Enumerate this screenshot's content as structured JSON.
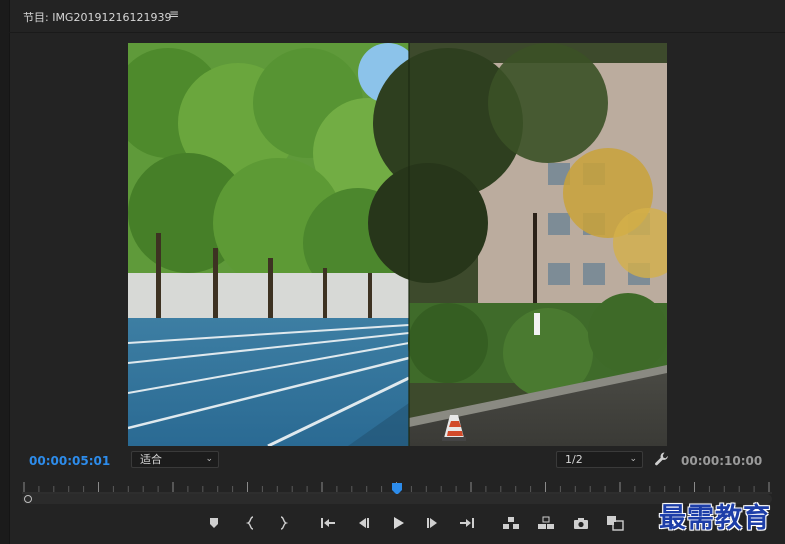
{
  "panel": {
    "title": "节目: IMG20191216121939",
    "menu_glyph": "≡"
  },
  "playback": {
    "current_time": "00:00:05:01",
    "duration": "00:00:10:00",
    "zoom_level": "适合",
    "resolution": "1/2",
    "playhead_fraction": 0.5
  },
  "controls": [
    {
      "name": "add-marker-button",
      "icon": "marker-icon"
    },
    {
      "name": "mark-in-button",
      "icon": "mark-in-icon"
    },
    {
      "name": "mark-out-button",
      "icon": "mark-out-icon"
    },
    {
      "name": "go-to-in-button",
      "icon": "go-to-in-icon"
    },
    {
      "name": "step-back-button",
      "icon": "step-back-icon"
    },
    {
      "name": "play-button",
      "icon": "play-icon"
    },
    {
      "name": "step-forward-button",
      "icon": "step-forward-icon"
    },
    {
      "name": "go-to-out-button",
      "icon": "go-to-out-icon"
    },
    {
      "name": "lift-button",
      "icon": "lift-icon"
    },
    {
      "name": "extract-button",
      "icon": "extract-icon"
    },
    {
      "name": "export-frame-button",
      "icon": "camera-icon"
    },
    {
      "name": "comparison-view-button",
      "icon": "comparison-icon"
    }
  ],
  "colors": {
    "timecode_active": "#2d8ceb",
    "playhead": "#2d8ceb",
    "panel_bg": "#232323"
  },
  "watermark": "最需教育"
}
